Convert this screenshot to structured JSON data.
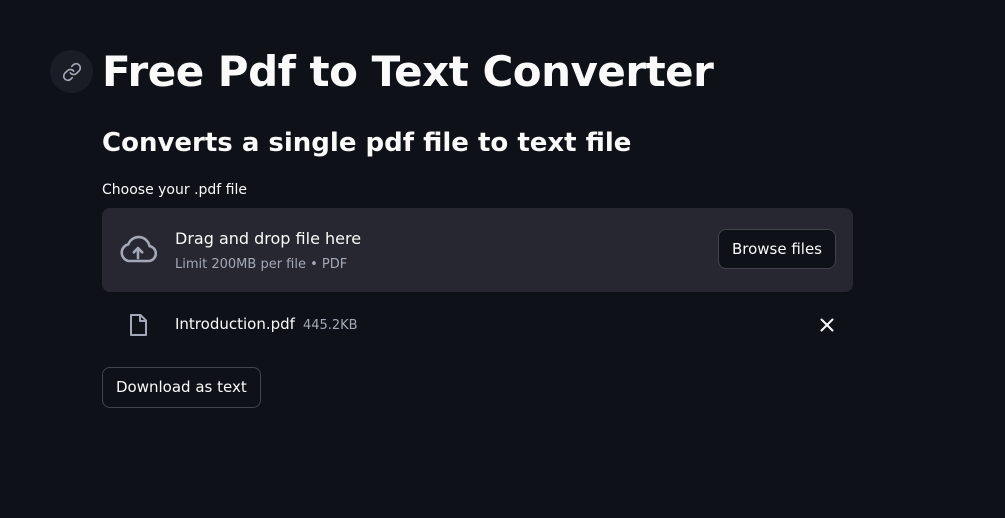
{
  "header": {
    "title": "Free Pdf to Text Converter",
    "anchor_icon": "link-icon"
  },
  "subheader": {
    "text": "Converts a single pdf file to text file"
  },
  "uploader": {
    "label": "Choose your .pdf file",
    "dropzone_icon": "cloud-upload-icon",
    "dropzone_title": "Drag and drop file here",
    "dropzone_limit": "Limit 200MB per file • PDF",
    "browse_label": "Browse files"
  },
  "uploaded_file": {
    "icon": "file-icon",
    "name": "Introduction.pdf",
    "size": "445.2KB",
    "remove_icon": "close-icon"
  },
  "actions": {
    "download_label": "Download as text"
  },
  "colors": {
    "background": "#0e1117",
    "dropzone": "#262730",
    "text": "#fafafa",
    "muted_text": "#a3a8b8"
  }
}
